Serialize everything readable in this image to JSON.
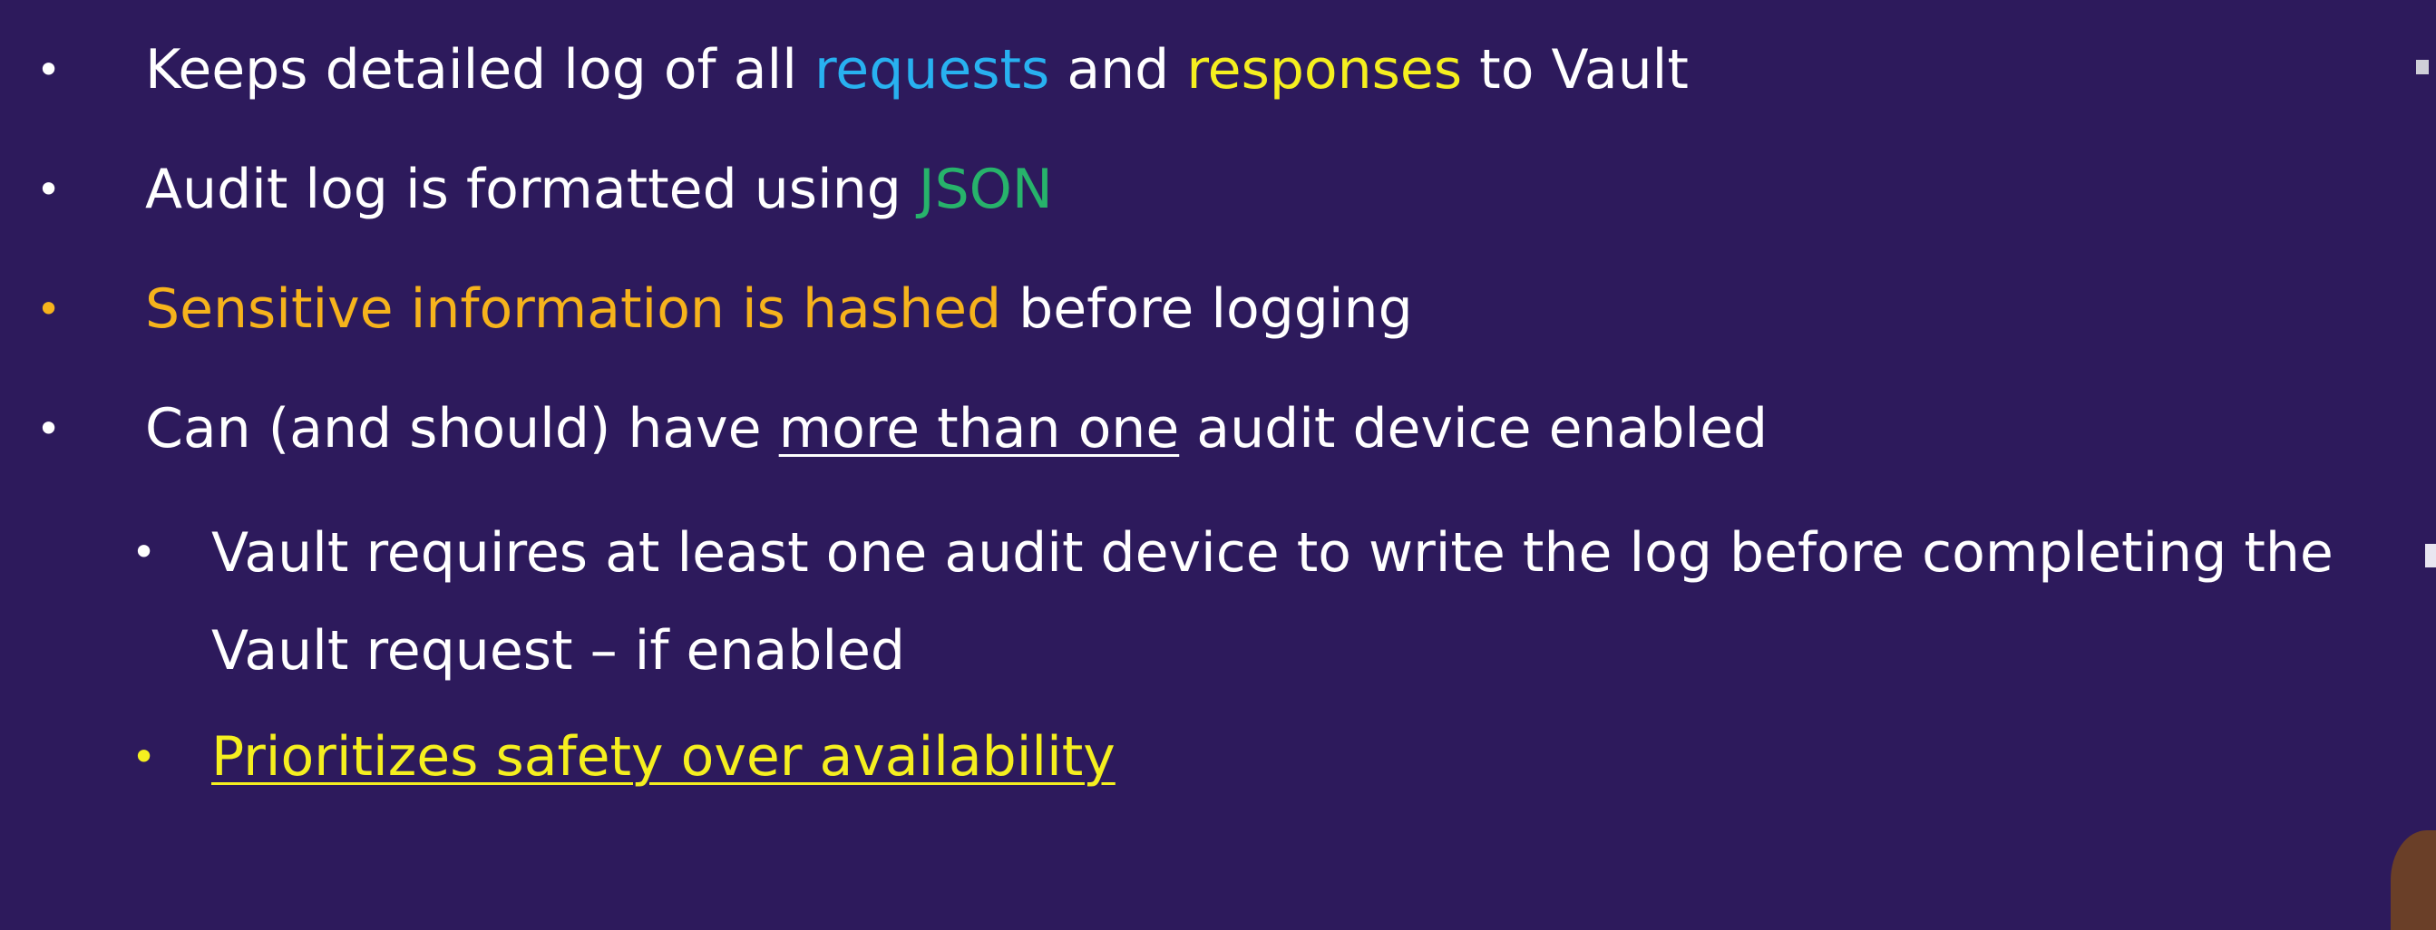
{
  "bullets": [
    {
      "level": 1,
      "bullet_color": "#ffffff",
      "segments": [
        {
          "text": "Keeps detailed log of all ",
          "color": "#ffffff"
        },
        {
          "text": "requests",
          "color": "#28b1f0"
        },
        {
          "text": " and ",
          "color": "#ffffff"
        },
        {
          "text": "responses",
          "color": "#f5ef1f"
        },
        {
          "text": " to Vault",
          "color": "#ffffff"
        }
      ]
    },
    {
      "level": 1,
      "bullet_color": "#ffffff",
      "segments": [
        {
          "text": "Audit log is formatted using ",
          "color": "#ffffff"
        },
        {
          "text": "JSON",
          "color": "#27b36b"
        }
      ]
    },
    {
      "level": 1,
      "bullet_color": "#f6b31c",
      "segments": [
        {
          "text": "Sensitive information is hashed",
          "color": "#f6b31c"
        },
        {
          "text": " before logging",
          "color": "#ffffff"
        }
      ]
    },
    {
      "level": 1,
      "bullet_color": "#ffffff",
      "segments": [
        {
          "text": "Can (and should) have ",
          "color": "#ffffff"
        },
        {
          "text": "more than one",
          "color": "#ffffff",
          "underline": true
        },
        {
          "text": " audit device enabled",
          "color": "#ffffff"
        }
      ]
    },
    {
      "level": 2,
      "bullet_color": "#ffffff",
      "segments": [
        {
          "text": "Vault requires at least one audit device to write the log before completing the Vault request – if enabled",
          "color": "#ffffff"
        }
      ]
    },
    {
      "level": 2,
      "bullet_color": "#f5ef1f",
      "segments": [
        {
          "text": "Prioritizes safety over availability",
          "color": "#f5ef1f",
          "underline": true
        }
      ]
    }
  ],
  "bullet_glyph": "•",
  "background_color": "#2d1a5c"
}
